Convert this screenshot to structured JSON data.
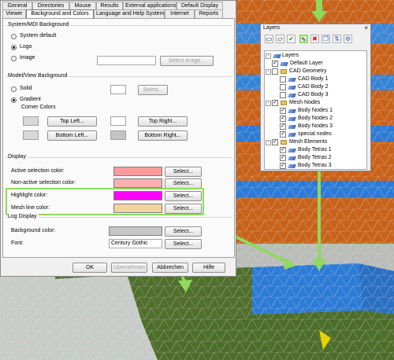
{
  "tabs_row1": [
    "General",
    "Directories",
    "Mouse",
    "Results",
    "External applications",
    "Default Display"
  ],
  "tabs_row2": [
    "Viewer",
    "Background and Colors",
    "Language and Help System",
    "Internet",
    "Reports"
  ],
  "active_tab": "Background and Colors",
  "system_bg": {
    "title": "System/MDI Background",
    "options": [
      "System default",
      "Logo",
      "Image"
    ],
    "selected": "Logo",
    "image_field": "",
    "select_image": "Select image..."
  },
  "model_bg": {
    "title": "Model/View Background",
    "options": [
      "Solid",
      "Gradient"
    ],
    "selected": "Gradient",
    "select": "Select...",
    "corner_title": "Corner Colors",
    "corners": [
      "Top Left...",
      "Top Right...",
      "Bottom Left...",
      "Bottom Right..."
    ]
  },
  "display": {
    "title": "Display",
    "rows": [
      {
        "label": "Active selection color:",
        "button": "Select...",
        "color": "#ff9a9a"
      },
      {
        "label": "Non-active selection color:",
        "button": "Select...",
        "color": "#ffb0b0"
      },
      {
        "label": "Highlight color:",
        "button": "Select...",
        "color": "#ff00ff"
      },
      {
        "label": "Mesh line color:",
        "button": "Select...",
        "color": "#f2d4a0"
      }
    ]
  },
  "log_display": {
    "title": "Log Display",
    "bg_label": "Background color:",
    "bg_color": "#c6c6c6",
    "bg_button": "Select...",
    "font_label": "Font:",
    "font_value": "Century Gothic",
    "font_button": "Select..."
  },
  "footer": [
    "OK",
    "Übernehmen",
    "Abbrechen",
    "Hilfe"
  ],
  "layers": {
    "title": "Layers",
    "close": "×",
    "toolbar": [
      "new-layer-icon",
      "folder-icon",
      "check-icon",
      "pin-icon",
      "delete-icon",
      "copy-icon",
      "move-icon",
      "settings-icon"
    ],
    "tree": [
      {
        "label": "Layers",
        "level": 0,
        "checked": null,
        "expander": "-"
      },
      {
        "label": "Default Layer",
        "level": 1,
        "checked": true
      },
      {
        "label": "CAD Geometry",
        "level": 1,
        "checked": false,
        "expander": "-"
      },
      {
        "label": "CAD Body 1",
        "level": 2,
        "checked": false
      },
      {
        "label": "CAD Body 2",
        "level": 2,
        "checked": false
      },
      {
        "label": "CAD Body 3",
        "level": 2,
        "checked": false
      },
      {
        "label": "Mesh Nodes",
        "level": 1,
        "checked": true,
        "expander": "-"
      },
      {
        "label": "Body Nodes 1",
        "level": 2,
        "checked": true
      },
      {
        "label": "Body Nodes 2",
        "level": 2,
        "checked": true
      },
      {
        "label": "Body Nodes 3",
        "level": 2,
        "checked": true
      },
      {
        "label": "special nodes",
        "level": 2,
        "checked": true
      },
      {
        "label": "Mesh Elements",
        "level": 1,
        "checked": true,
        "expander": "-"
      },
      {
        "label": "Body Tetras 1",
        "level": 2,
        "checked": true
      },
      {
        "label": "Body Tetras 2",
        "level": 2,
        "checked": true
      },
      {
        "label": "Body Tetras 3",
        "level": 2,
        "checked": true
      }
    ]
  },
  "colors": {
    "accent_green": "#8fd95c",
    "mesh_orange": "#c8621a",
    "mesh_blue": "#2c7bd6",
    "mesh_green": "#4c6e2a",
    "mesh_gray": "#b9bcb8"
  }
}
